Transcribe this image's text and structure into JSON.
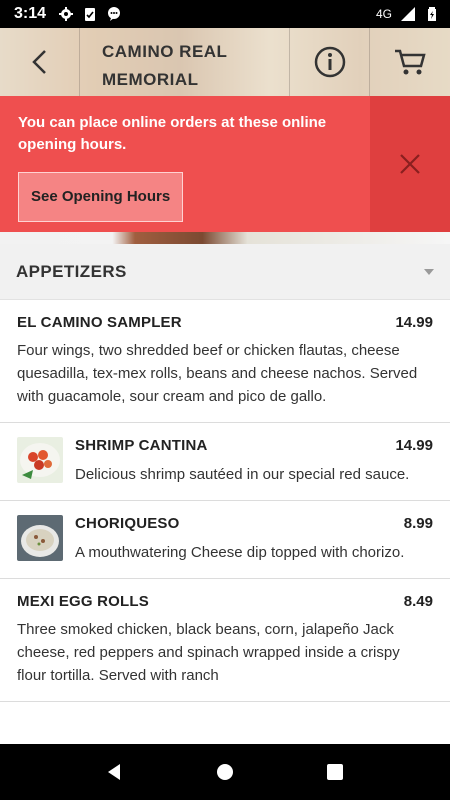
{
  "status_bar": {
    "time": "3:14",
    "network": "4G"
  },
  "header": {
    "title_line1": "CAMINO REAL",
    "title_line2": "MEMORIAL"
  },
  "banner": {
    "message": "You can place online orders at these online opening hours.",
    "button_label": "See Opening Hours"
  },
  "section": {
    "title": "APPETIZERS"
  },
  "items": [
    {
      "name": "EL CAMINO SAMPLER",
      "price": "14.99",
      "description": "Four wings, two shredded beef or chicken flautas, cheese quesadilla, tex-mex rolls, beans and cheese nachos. Served with guacamole, sour cream and pico de gallo."
    },
    {
      "name": "SHRIMP CANTINA",
      "price": "14.99",
      "description": "Delicious shrimp sautéed in our special red sauce."
    },
    {
      "name": "CHORIQUESO",
      "price": "8.99",
      "description": "A mouthwatering Cheese dip topped with chorizo."
    },
    {
      "name": "MEXI EGG ROLLS",
      "price": "8.49",
      "description": "Three smoked chicken, black beans, corn, jalapeño Jack cheese, red peppers and spinach wrapped inside a crispy flour tortilla. Served with ranch"
    }
  ],
  "icons": {
    "back": "back-arrow-icon",
    "info": "info-icon",
    "cart": "cart-icon",
    "close": "close-icon",
    "caret": "caret-down-icon"
  },
  "colors": {
    "banner": "#ef4f4f",
    "banner_close": "#df3f3f",
    "banner_button": "#f58484",
    "section_bg": "#f1f1f1"
  }
}
